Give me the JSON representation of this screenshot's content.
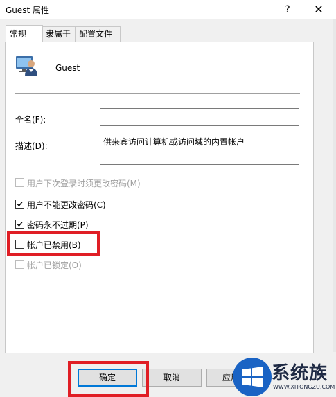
{
  "window": {
    "title": "Guest 属性",
    "help_glyph": "?",
    "close_glyph": "✕"
  },
  "tabs": [
    {
      "label": "常规",
      "active": true
    },
    {
      "label": "隶属于",
      "active": false
    },
    {
      "label": "配置文件",
      "active": false
    }
  ],
  "general": {
    "user_icon": "user-monitor-icon",
    "user_name": "Guest",
    "fullname_label": "全名(F):",
    "fullname_value": "",
    "description_label": "描述(D):",
    "description_value": "供来宾访问计算机或访问域的内置帐户"
  },
  "checkboxes": [
    {
      "label": "用户下次登录时须更改密码(M)",
      "checked": false,
      "enabled": false
    },
    {
      "label": "用户不能更改密码(C)",
      "checked": true,
      "enabled": true
    },
    {
      "label": "密码永不过期(P)",
      "checked": true,
      "enabled": true
    },
    {
      "label": "帐户已禁用(B)",
      "checked": false,
      "enabled": true
    },
    {
      "label": "帐户已锁定(O)",
      "checked": false,
      "enabled": false
    }
  ],
  "buttons": {
    "ok": "确定",
    "cancel": "取消",
    "apply": "应用"
  },
  "watermark": {
    "brand": "系统族",
    "url": "WWW.XITONGZU.COM"
  },
  "colors": {
    "highlight": "#e01e25",
    "focus_border": "#0078d7",
    "watermark_blue": "#1a63c4"
  }
}
